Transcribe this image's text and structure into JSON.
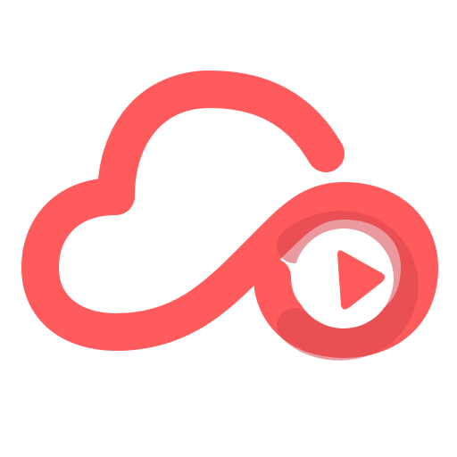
{
  "logo": {
    "icon": "cloud-infinity-play-icon",
    "colors": {
      "primary": "#FF5A5C",
      "shadow": "#D9474E",
      "play": "#FF5A5C",
      "background": "#FFFFFF"
    }
  }
}
